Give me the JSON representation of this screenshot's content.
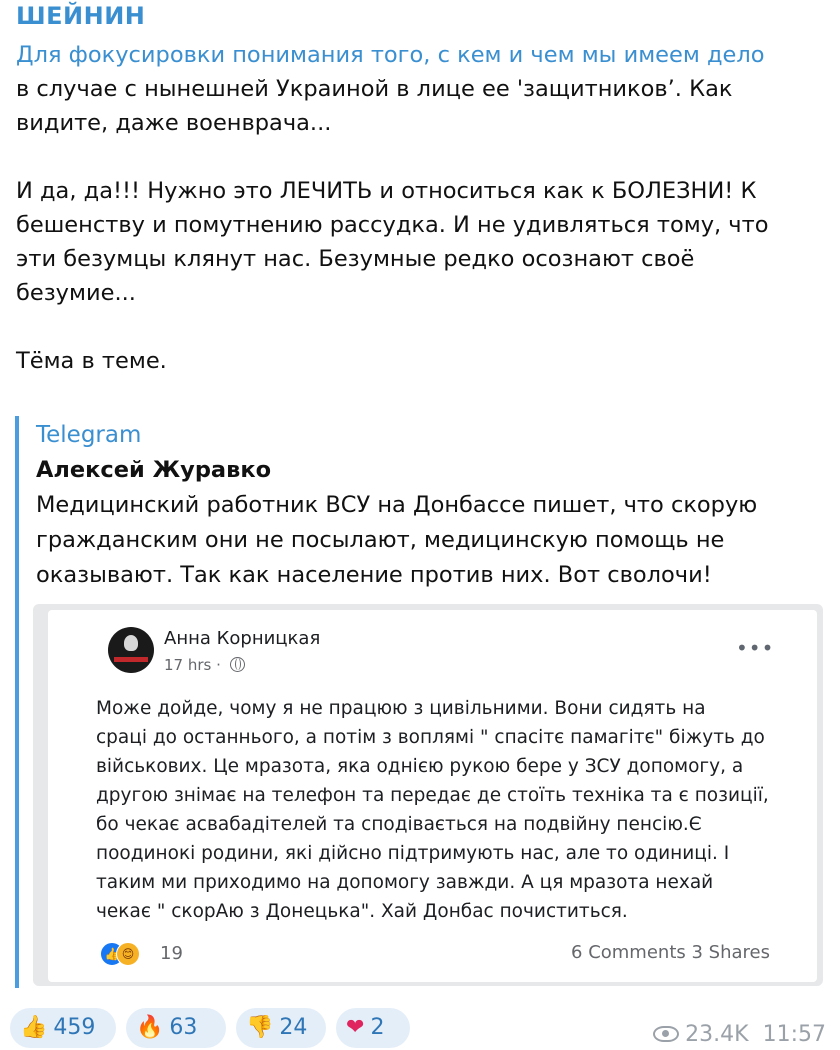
{
  "channel": {
    "title": "ШЕЙНИН"
  },
  "message": {
    "lines": [
      "Для фокусировки понимания того, с кем и чем мы имеем дело",
      "в случае с нынешней Украиной в лице ее 'защитников’. Как",
      "видите, даже военврача...",
      "И да, да!!! Нужно это ЛЕЧИТЬ и относиться как к БОЛЕЗНИ! К",
      "бешенству и помутнению рассудка. И не удивляться тому, что",
      "эти безумцы клянут нас. Безумные редко осознают своё",
      "безумие...",
      "Тёма в теме."
    ]
  },
  "forward": {
    "source": "Telegram",
    "author": "Алексей Журавко",
    "lines": [
      "Медицинский работник ВСУ на Донбассе пишет, что скорую",
      "гражданским они не посылают, медицинскую помощь не",
      "оказывают. Так как население против них.  Вот сволочи!"
    ]
  },
  "fb_post": {
    "author": "Анна Корницкая",
    "time": "17 hrs · ",
    "more": "•••",
    "lines": [
      "Може дойде, чому я не працюю з цивільними. Вони сидять на",
      "сраці до останнього, а потім з воплямі \" спасітє памагітє\" біжуть до",
      "військових. Це мразота, яка однією рукою бере у ЗСУ допомогу, а",
      "другою знімає на телефон та передає де стоїть техніка та є позиції,",
      "бо чекає асвабадітелей та сподівається на подвійну пенсію.Є",
      "поодинокі родини, які дійсно підтримують нас, але то одиниці. І",
      "таким ми приходимо на допомогу завжди. А ця мразота нехай",
      "чекає \" скорАю з Донецька\". Хай Донбас почиститься."
    ],
    "reaction_count": "19",
    "comments": "6 Comments",
    "shares": "3 Shares",
    "reaction_icons": [
      "like-icon",
      "care-icon"
    ]
  },
  "reactions": [
    {
      "emoji": "👍",
      "count": "459",
      "name": "thumbs-up"
    },
    {
      "emoji": "🔥",
      "count": "63",
      "name": "fire"
    },
    {
      "emoji": "👎",
      "count": "24",
      "name": "thumbs-down"
    },
    {
      "emoji": "❤",
      "count": "2",
      "name": "heart"
    }
  ],
  "footer": {
    "views": "23.4K",
    "time": "11:57"
  },
  "colors": {
    "accent": "#3a8fd1",
    "pill_bg": "#e4eef8",
    "meta": "#9aa1a8"
  }
}
